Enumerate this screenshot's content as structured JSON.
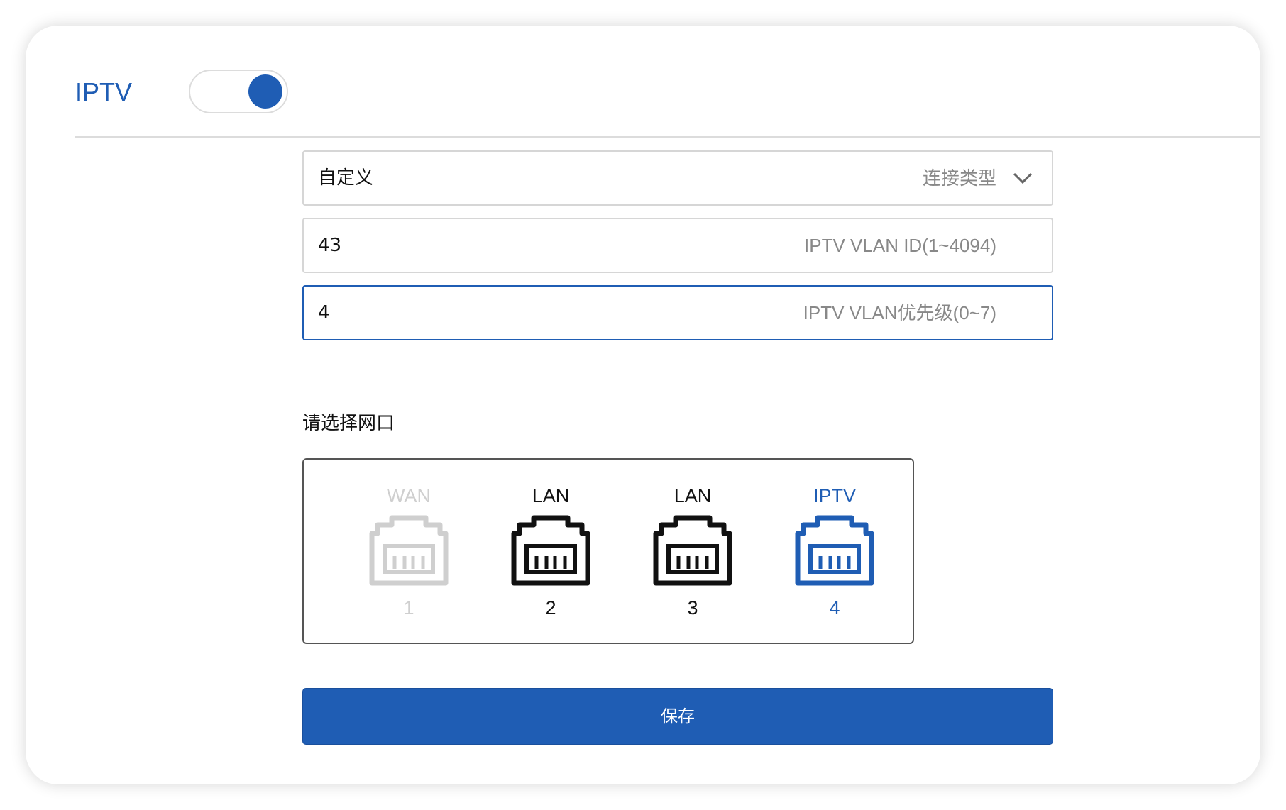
{
  "header": {
    "title": "IPTV",
    "toggle_on": true
  },
  "form": {
    "connection_type": {
      "value": "自定义",
      "label": "连接类型",
      "icon": "chevron-down-icon"
    },
    "vlan_id": {
      "value": "43",
      "label": "IPTV VLAN ID(1~4094)"
    },
    "vlan_priority": {
      "value": "4",
      "label": "IPTV VLAN优先级(0~7)"
    },
    "port_section_label": "请选择网口",
    "ports": [
      {
        "label": "WAN",
        "number": "1",
        "state": "disabled",
        "icon": "ethernet-port-icon"
      },
      {
        "label": "LAN",
        "number": "2",
        "state": "normal",
        "icon": "ethernet-port-icon"
      },
      {
        "label": "LAN",
        "number": "3",
        "state": "normal",
        "icon": "ethernet-port-icon"
      },
      {
        "label": "IPTV",
        "number": "4",
        "state": "active",
        "icon": "ethernet-port-icon"
      }
    ],
    "save_label": "保存"
  },
  "colors": {
    "accent": "#1f5db4",
    "disabled": "#cfcfcf",
    "text": "#111111",
    "muted": "#888888"
  }
}
